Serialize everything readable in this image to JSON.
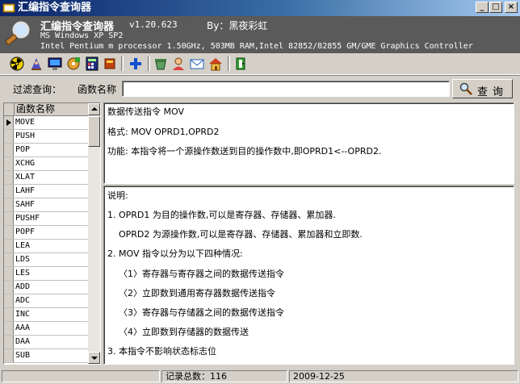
{
  "window": {
    "title": "汇编指令查询器"
  },
  "titlebar_buttons": {
    "minimize": "_",
    "maximize": "□",
    "close": "×"
  },
  "header": {
    "app_name": "汇编指令查询器",
    "version": "v1.20.623",
    "author": "By：黑夜彩虹",
    "os_line": "MS Windows XP SP2",
    "cpu_line": "Intel Pentium m processor 1.50GHz, 503MB RAM,Intel 82852/82855 GM/GME Graphics Controller"
  },
  "toolbar": {
    "icons": [
      "radiation-icon",
      "wizard-icon",
      "monitor-icon",
      "disk-icon",
      "calculator-icon",
      "book-icon",
      "add-icon",
      "recycle-icon",
      "user-icon",
      "mail-icon",
      "home-icon",
      "exit-icon"
    ]
  },
  "filter": {
    "label": "过滤查询：",
    "field_label": "函数名称",
    "search_value": "",
    "button_label": "查询"
  },
  "list": {
    "header": "函数名称",
    "selected_index": 0,
    "items": [
      "MOVE",
      "PUSH",
      "POP",
      "XCHG",
      "XLAT",
      "LAHF",
      "SAHF",
      "PUSHF",
      "POPF",
      "LEA",
      "LDS",
      "LES",
      "ADD",
      "ADC",
      "INC",
      "AAA",
      "DAA",
      "SUB"
    ]
  },
  "detail": {
    "title": "数据传送指令 MOV",
    "format": "格式: MOV OPRD1,OPRD2",
    "function": "功能: 本指令将一个源操作数送到目的操作数中,即OPRD1<--OPRD2."
  },
  "notes": {
    "heading": "说明:",
    "lines": [
      "1. OPRD1 为目的操作数,可以是寄存器、存储器、累加器.",
      "   OPRD2 为源操作数,可以是寄存器、存储器、累加器和立即数.",
      "2. MOV 指令以分为以下四种情况:",
      "   〈1〉寄存器与寄存器之间的数据传送指令",
      "   〈2〉立即数到通用寄存器数据传送指令",
      "   〈3〉寄存器与存储器之间的数据传送指令",
      "   〈4〉立即数到存储器的数据传送",
      "3. 本指令不影响状态标志位"
    ]
  },
  "status": {
    "record_count": "记录总数：116",
    "date": "2009-12-25"
  }
}
